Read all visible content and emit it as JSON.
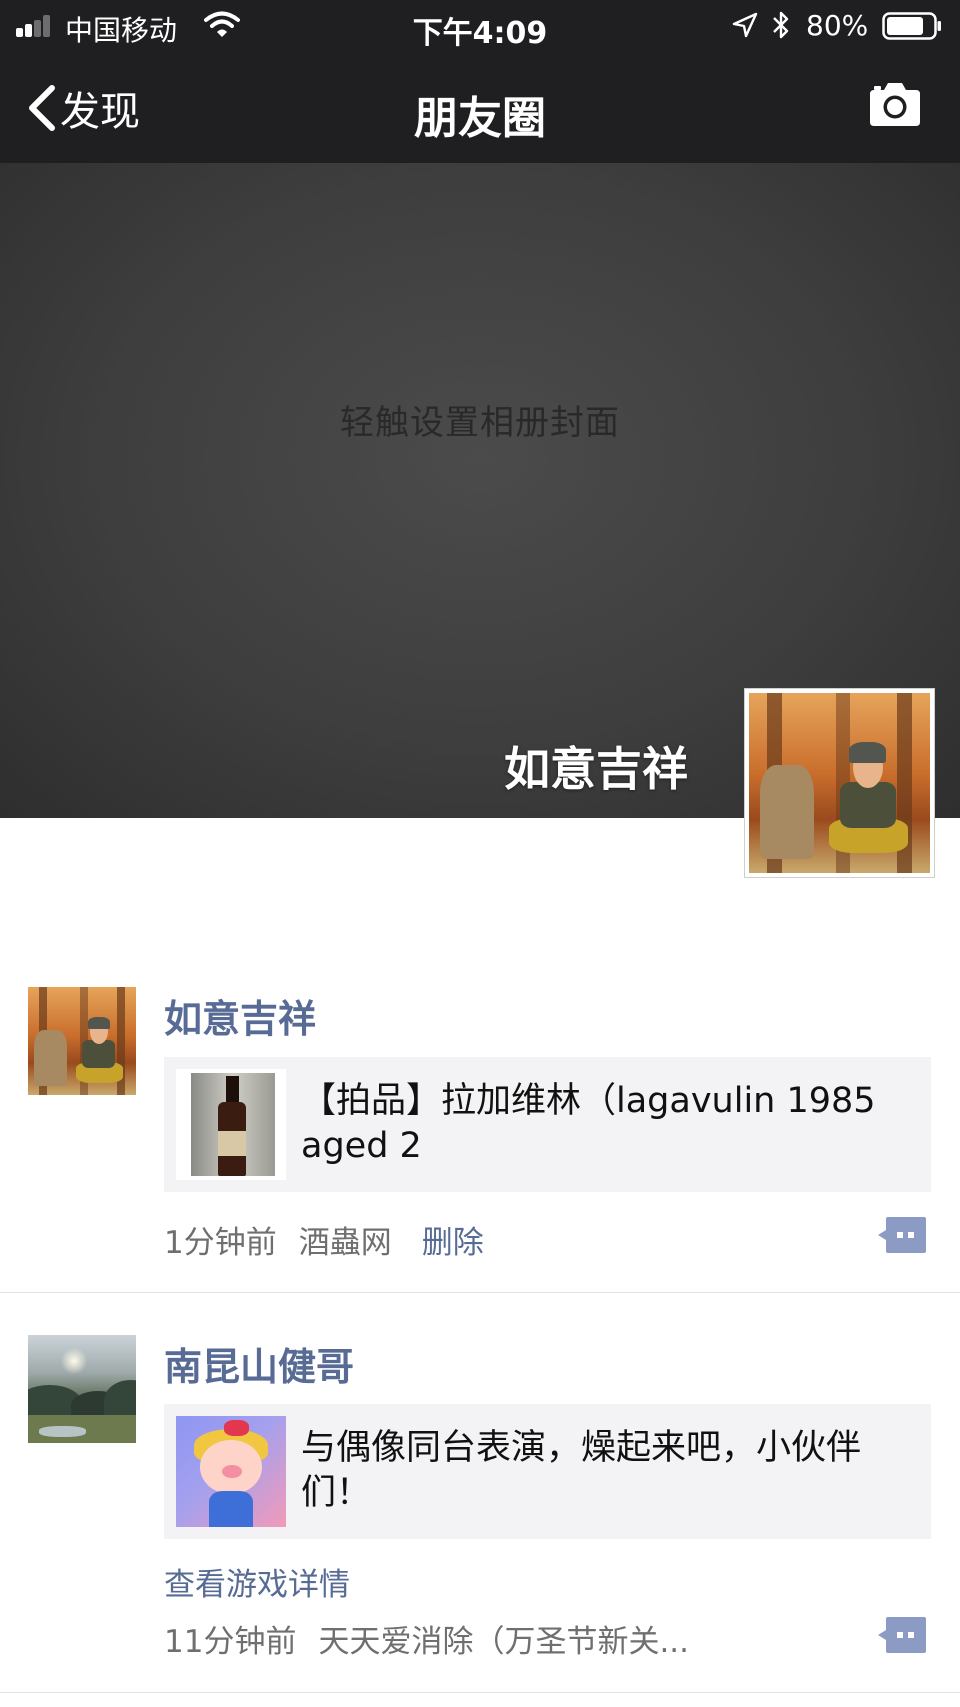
{
  "status_bar": {
    "carrier": "中国移动",
    "time": "下午4:09",
    "battery_percent": "80%",
    "battery_level": 0.8,
    "signal_bars_filled": 2,
    "icons": [
      "signal-icon",
      "wifi-icon",
      "location-icon",
      "bluetooth-icon",
      "battery-icon"
    ]
  },
  "nav": {
    "back_label": "发现",
    "title": "朋友圈",
    "camera_icon": "camera-icon"
  },
  "cover": {
    "hint": "轻触设置相册封面",
    "owner_name": "如意吉祥"
  },
  "colors": {
    "bar_bg": "#1f1f22",
    "name_link": "#576b95",
    "card_bg": "#f3f3f5"
  },
  "posts": [
    {
      "author": "如意吉祥",
      "card_text": "【拍品】拉加维林（lagavulin 1985 aged 2",
      "time_ago": "1分钟前",
      "source": "酒蟲网",
      "delete_label": "删除"
    },
    {
      "author": "南昆山健哥",
      "card_text": "与偶像同台表演，燥起来吧，小伙伴们！",
      "link_text": "查看游戏详情",
      "time_ago": "11分钟前",
      "source": "天天爱消除（万圣节新关..."
    }
  ]
}
